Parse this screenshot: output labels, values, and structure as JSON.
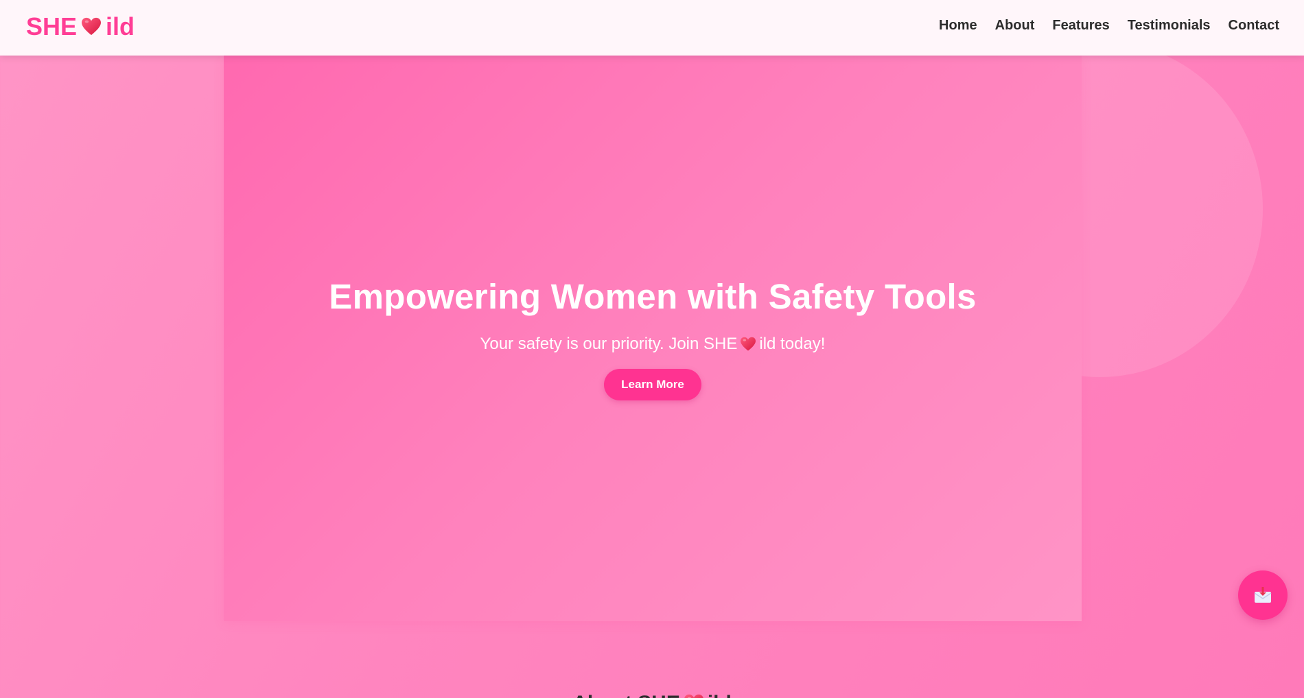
{
  "brand": {
    "name_prefix": "SHE",
    "name_suffix": "ild",
    "logo_color": "#ff3d95",
    "heart_icon": "heart-icon"
  },
  "nav": {
    "items": [
      "Home",
      "About",
      "Features",
      "Testimonials",
      "Contact"
    ]
  },
  "hero": {
    "title": "Empowering Women with Safety Tools",
    "subtitle_prefix": "Your safety is our priority. Join SHE",
    "subtitle_suffix": "ild today!",
    "button_label": "Learn More",
    "button_color": "#ff3391"
  },
  "fab": {
    "icon": "inbox-download-icon"
  },
  "about": {
    "title_prefix": "About SHE",
    "title_suffix": "ild"
  }
}
